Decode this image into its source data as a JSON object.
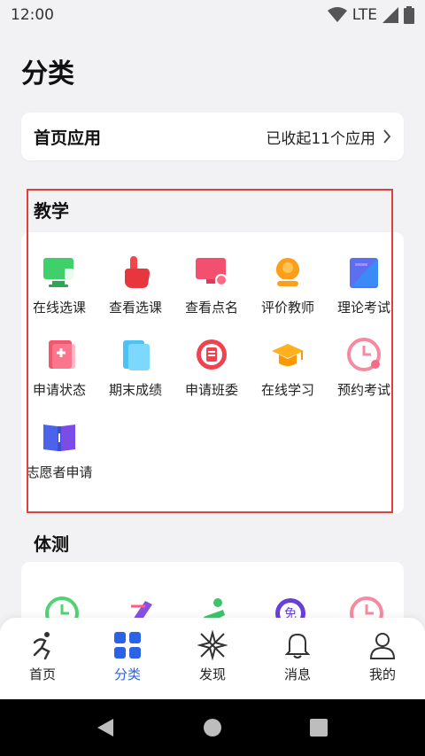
{
  "status": {
    "time": "12:00",
    "network": "LTE"
  },
  "page_title": "分类",
  "home_apps": {
    "title": "首页应用",
    "summary": "已收起11个应用"
  },
  "sections": {
    "teaching": {
      "title": "教学",
      "items": [
        {
          "label": "在线选课",
          "icon": "monitor-select-icon"
        },
        {
          "label": "查看选课",
          "icon": "hand-pointer-icon"
        },
        {
          "label": "查看点名",
          "icon": "screen-roll-call-icon"
        },
        {
          "label": "评价教师",
          "icon": "teacher-rating-icon"
        },
        {
          "label": "理论考试",
          "icon": "theory-exam-icon"
        },
        {
          "label": "申请状态",
          "icon": "application-status-icon"
        },
        {
          "label": "期末成绩",
          "icon": "final-grades-icon"
        },
        {
          "label": "申请班委",
          "icon": "class-committee-icon"
        },
        {
          "label": "在线学习",
          "icon": "graduation-cap-icon"
        },
        {
          "label": "预约考试",
          "icon": "exam-appointment-clock-icon"
        },
        {
          "label": "志愿者申请",
          "icon": "volunteer-book-icon"
        }
      ]
    },
    "fitness": {
      "title": "体测"
    }
  },
  "tabbar": {
    "items": [
      {
        "label": "首页",
        "icon": "runner-icon"
      },
      {
        "label": "分类",
        "icon": "grid-icon"
      },
      {
        "label": "发现",
        "icon": "compass-icon"
      },
      {
        "label": "消息",
        "icon": "bell-icon"
      },
      {
        "label": "我的",
        "icon": "user-icon"
      }
    ],
    "active_index": 1
  },
  "colors": {
    "accent": "#2b63e6",
    "highlight": "#e0403a"
  }
}
